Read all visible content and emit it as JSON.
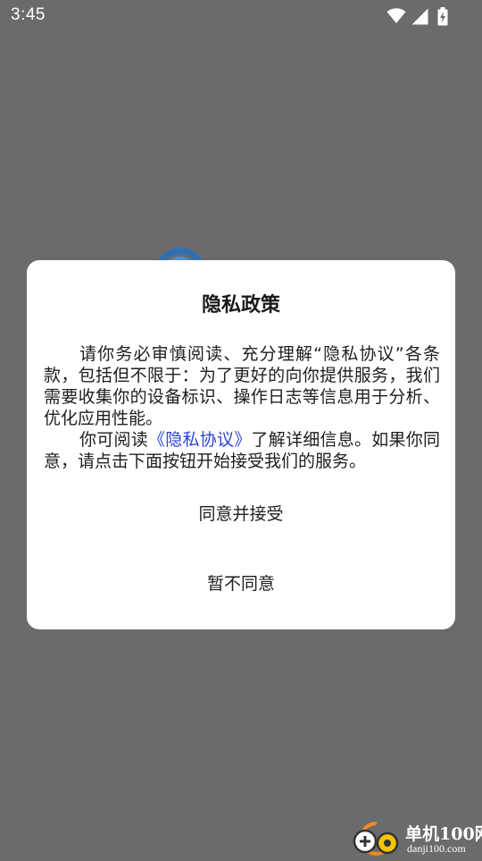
{
  "status_bar": {
    "time": "3:45"
  },
  "dialog": {
    "title": "隐私政策",
    "paragraph1": "请你务必审慎阅读、充分理解“隐私协议”各条款，包括但不限于：为了更好的向你提供服务，我们需要收集你的设备标识、操作日志等信息用于分析、优化应用性能。",
    "paragraph2_before": "你可阅读",
    "paragraph2_link": "《隐私协议》",
    "paragraph2_after": "了解详细信息。如果你同意，请点击下面按钮开始接受我们的服务。",
    "agree_label": "同意并接受",
    "disagree_label": "暂不同意"
  },
  "watermark": {
    "name": "单机100网",
    "url": "danji100.com"
  },
  "colors": {
    "overlay": "#6b6b6b",
    "dialog_bg": "#ffffff",
    "link": "#2b46d6",
    "watermark_accent": "#f08a24"
  },
  "icons": [
    "wifi-icon",
    "signal-icon",
    "battery-icon",
    "app-logo-icon",
    "site-logo-icon"
  ]
}
